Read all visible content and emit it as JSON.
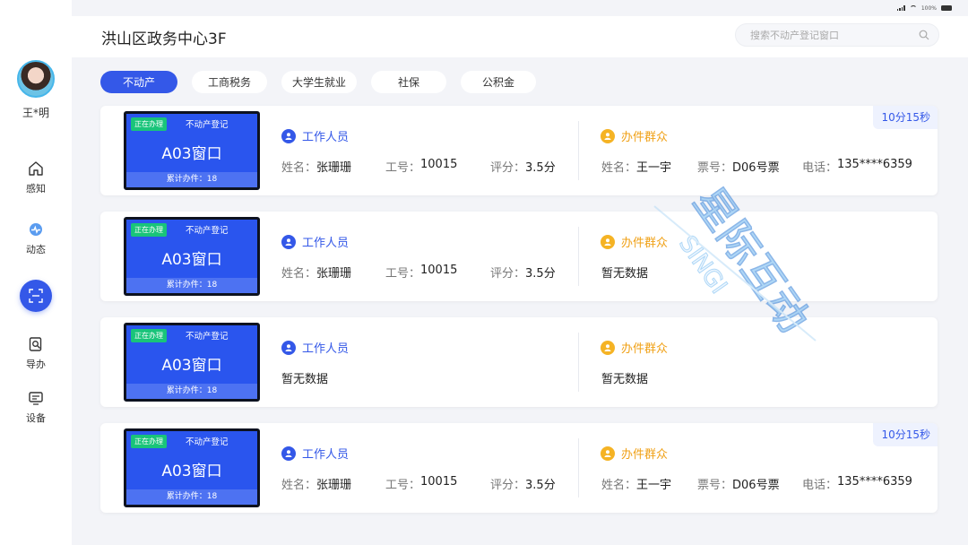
{
  "status_bar": {
    "battery": "100%"
  },
  "sidebar": {
    "user_name": "王*明",
    "items": [
      {
        "label": "感知",
        "icon": "home-icon"
      },
      {
        "label": "动态",
        "icon": "activity-icon"
      },
      {
        "label": "导办",
        "icon": "guide-icon"
      },
      {
        "label": "设备",
        "icon": "device-icon"
      }
    ]
  },
  "header": {
    "title": "洪山区政务中心3F",
    "search_placeholder": "搜索不动产登记窗口"
  },
  "tabs": [
    "不动产",
    "工商税务",
    "大学生就业",
    "社保",
    "公积金"
  ],
  "active_tab": "不动产",
  "labels": {
    "staff": "工作人员",
    "citizen": "办件群众",
    "name": "姓名：",
    "staff_no": "工号：",
    "score": "评分：",
    "ticket": "票号：",
    "phone": "电话：",
    "empty": "暂无数据"
  },
  "windows": [
    {
      "status": "正在办理",
      "service": "不动产登记",
      "window": "A03窗口",
      "count_text": "累计办件：18",
      "staff": {
        "name": "张珊珊",
        "no": "10015",
        "score": "3.5分"
      },
      "citizen": {
        "name": "王一宇",
        "ticket": "D06号票",
        "phone": "135****6359"
      },
      "timer": "10分15秒"
    },
    {
      "status": "正在办理",
      "service": "不动产登记",
      "window": "A03窗口",
      "count_text": "累计办件：18",
      "staff": {
        "name": "张珊珊",
        "no": "10015",
        "score": "3.5分"
      },
      "citizen": null,
      "timer": ""
    },
    {
      "status": "正在办理",
      "service": "不动产登记",
      "window": "A03窗口",
      "count_text": "累计办件：18",
      "staff": null,
      "citizen": null,
      "timer": ""
    },
    {
      "status": "正在办理",
      "service": "不动产登记",
      "window": "A03窗口",
      "count_text": "累计办件：18",
      "staff": {
        "name": "张珊珊",
        "no": "10015",
        "score": "3.5分"
      },
      "citizen": {
        "name": "王一宇",
        "ticket": "D06号票",
        "phone": "135****6359"
      },
      "timer": "10分15秒"
    }
  ],
  "watermark_text": "星际互动 SINGI",
  "colors": {
    "primary": "#3458e8",
    "staff_blue": "#3458e8",
    "citizen_orange": "#f5b324",
    "status_green": "#19c47a"
  }
}
